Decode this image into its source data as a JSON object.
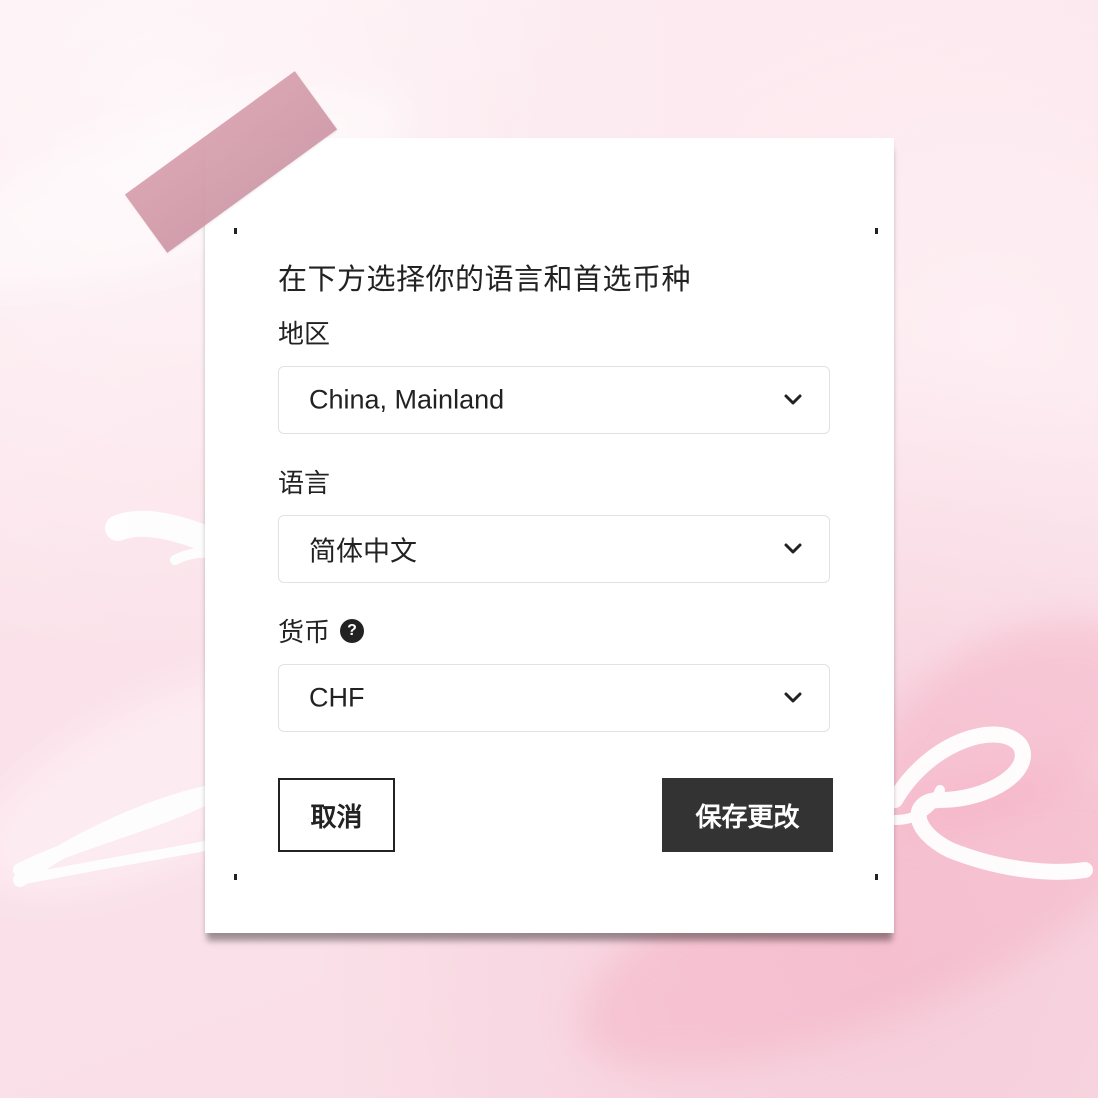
{
  "dialog": {
    "headline": "在下方选择你的语言和首选币种",
    "region": {
      "label": "地区",
      "value": "China, Mainland"
    },
    "language": {
      "label": "语言",
      "value": "简体中文"
    },
    "currency": {
      "label": "货币",
      "help_icon": "question-circle-icon",
      "help_glyph": "?",
      "value": "CHF"
    },
    "buttons": {
      "cancel": "取消",
      "save": "保存更改"
    }
  },
  "colors": {
    "background": "#fbe7ee",
    "tape": "#d49fae",
    "save_button": "#333333",
    "text": "#222222",
    "select_border": "#dfe3e6"
  }
}
